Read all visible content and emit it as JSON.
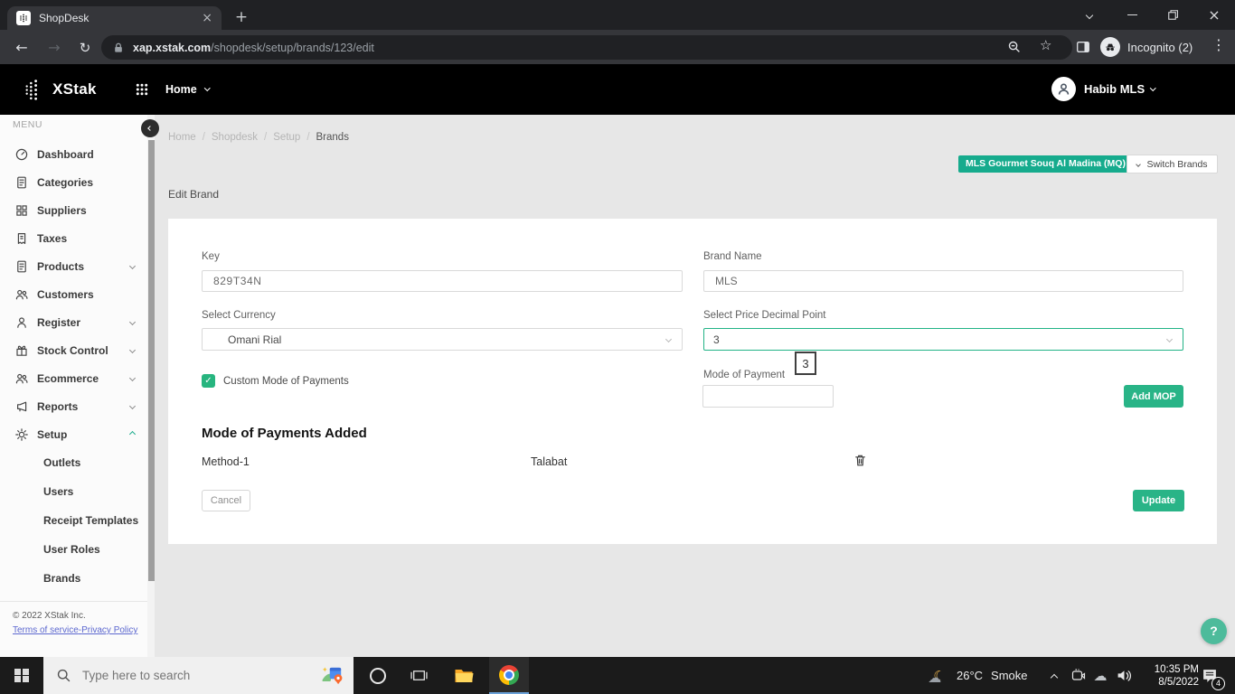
{
  "browser": {
    "tab_title": "ShopDesk",
    "url_host": "xap.xstak.com",
    "url_path": "/shopdesk/setup/brands/123/edit",
    "incognito_label": "Incognito (2)"
  },
  "header": {
    "logo_text": "XStak",
    "nav_home": "Home",
    "user_name": "Habib MLS"
  },
  "sidebar": {
    "menu_label": "MENU",
    "items": [
      {
        "label": "Dashboard"
      },
      {
        "label": "Categories"
      },
      {
        "label": "Suppliers"
      },
      {
        "label": "Taxes"
      },
      {
        "label": "Products"
      },
      {
        "label": "Customers"
      },
      {
        "label": "Register"
      },
      {
        "label": "Stock Control"
      },
      {
        "label": "Ecommerce"
      },
      {
        "label": "Reports"
      },
      {
        "label": "Setup"
      }
    ],
    "setup_children": [
      {
        "label": "Outlets"
      },
      {
        "label": "Users"
      },
      {
        "label": "Receipt Templates"
      },
      {
        "label": "User Roles"
      },
      {
        "label": "Brands"
      }
    ],
    "copyright": "© 2022 XStak Inc.",
    "terms_link": "Terms of service",
    "privacy_link": "Privacy Policy"
  },
  "breadcrumb": [
    {
      "label": "Home"
    },
    {
      "label": "Shopdesk"
    },
    {
      "label": "Setup"
    },
    {
      "label": "Brands"
    }
  ],
  "page": {
    "brand_badge": "MLS Gourmet Souq Al Madina (MQ)",
    "switch_brands_label": "Switch Brands",
    "title": "Edit Brand"
  },
  "form": {
    "key_label": "Key",
    "key_value": "829T34N",
    "brand_name_label": "Brand Name",
    "brand_name_value": "MLS",
    "currency_label": "Select Currency",
    "currency_value": "Omani Rial",
    "decimal_label": "Select Price Decimal Point",
    "decimal_value": "3",
    "decimal_tooltip": "3",
    "custom_mop_label": "Custom Mode of Payments",
    "mop_label": "Mode of Payment",
    "mop_value": "",
    "add_mop_label": "Add MOP",
    "mop_added_title": "Mode of Payments Added",
    "mop_rows": [
      {
        "name": "Method-1",
        "value": "Talabat"
      }
    ],
    "cancel_label": "Cancel",
    "update_label": "Update",
    "help_label": "?"
  },
  "taskbar": {
    "search_placeholder": "Type here to search",
    "weather_temp": "26°C",
    "weather_condition": "Smoke",
    "time": "10:35 PM",
    "date": "8/5/2022",
    "notification_count": "4"
  },
  "colors": {
    "accent_teal": "#16ab8d",
    "button_green": "#29b487"
  }
}
